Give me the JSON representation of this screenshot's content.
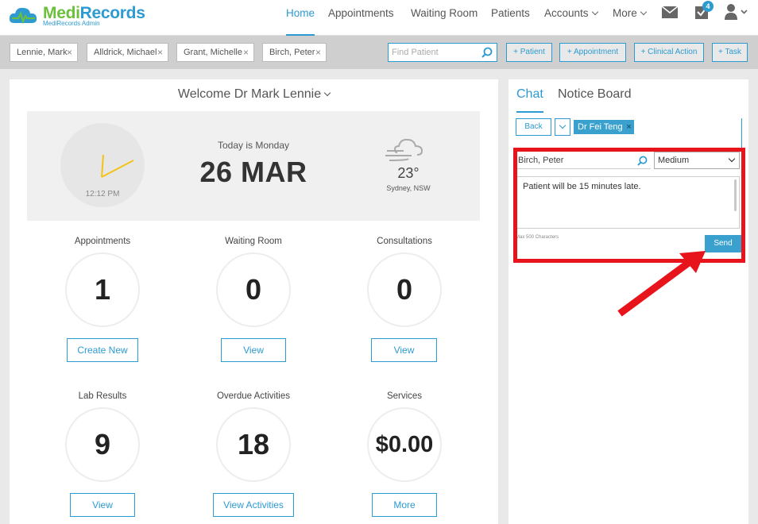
{
  "brand": {
    "name_part1": "Medi",
    "name_part2": "Records",
    "subtitle": "MediRecords Admin"
  },
  "nav": {
    "items": [
      {
        "label": "Home",
        "active": true
      },
      {
        "label": "Appointments"
      },
      {
        "label": "Waiting Room"
      },
      {
        "label": "Patients"
      },
      {
        "label": "Accounts"
      },
      {
        "label": "More"
      }
    ],
    "tasks_badge": "4"
  },
  "patient_tabs": [
    "Lennie, Mark",
    "Alldrick, Michael",
    "Grant, Michelle",
    "Birch, Peter"
  ],
  "search": {
    "placeholder": "Find Patient"
  },
  "actions": {
    "patient": "+ Patient",
    "appointment": "+ Appointment",
    "clinical_action": "+ Clinical Action",
    "task": "+ Task"
  },
  "dashboard": {
    "welcome": "Welcome Dr Mark Lennie",
    "clock_time": "12:12 PM",
    "today_label": "Today is Monday",
    "date": "26 MAR",
    "temperature": "23°",
    "location": "Sydney, NSW",
    "stats": [
      {
        "label": "Appointments",
        "value": "1",
        "button": "Create New"
      },
      {
        "label": "Waiting Room",
        "value": "0",
        "button": "View"
      },
      {
        "label": "Consultations",
        "value": "0",
        "button": "View"
      },
      {
        "label": "Lab Results",
        "value": "9",
        "button": "View"
      },
      {
        "label": "Overdue Activities",
        "value": "18",
        "button": "View Activities"
      },
      {
        "label": "Services",
        "value": "$0.00",
        "button": "More"
      }
    ]
  },
  "chat": {
    "tabs": [
      "Chat",
      "Notice Board"
    ],
    "back": "Back",
    "recipient": "Dr Fei Teng",
    "patient": "Birch, Peter",
    "priority": "Medium",
    "message": "Patient will be 15 minutes late.",
    "max_chars": "Max 500 Characters",
    "send": "Send"
  },
  "colors": {
    "accent": "#2d9bd1",
    "brand_green": "#6cbf3c",
    "annotation": "#e8141b"
  }
}
